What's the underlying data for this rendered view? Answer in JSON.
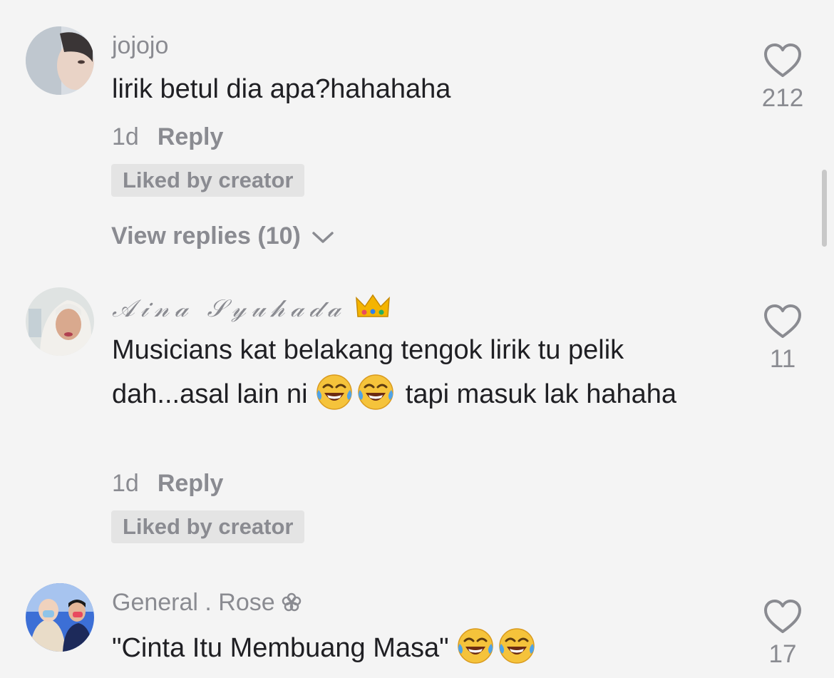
{
  "comments": [
    {
      "username": "jojojo",
      "text": "lirik betul dia apa?hahahaha",
      "time": "1d",
      "reply_label": "Reply",
      "liked_badge": "Liked by creator",
      "view_replies": "View replies (10)",
      "likes": "212"
    },
    {
      "username": "𝒜𝒾𝓃𝒶 𝒮𝓎𝓊𝒽𝒶𝒹𝒶",
      "text_part1": "Musicians kat belakang tengok lirik tu pelik dah...asal lain ni",
      "text_part2": "tapi masuk lak hahaha",
      "time": "1d",
      "reply_label": "Reply",
      "liked_badge": "Liked by creator",
      "likes": "11"
    },
    {
      "username": "General . Rose",
      "text": "\"Cinta Itu Membuang Masa\"",
      "likes": "17"
    }
  ],
  "icons": {
    "heart": "heart-outline-icon",
    "chevron": "chevron-down-icon",
    "emoji": "face-with-tears-of-joy-emoji",
    "crown": "crown-emoji",
    "flower": "flower-icon"
  },
  "colors": {
    "background": "#f4f4f4",
    "primary_text": "#1f1f23",
    "secondary_text": "#8a8b91",
    "badge_bg": "#e4e4e4"
  }
}
